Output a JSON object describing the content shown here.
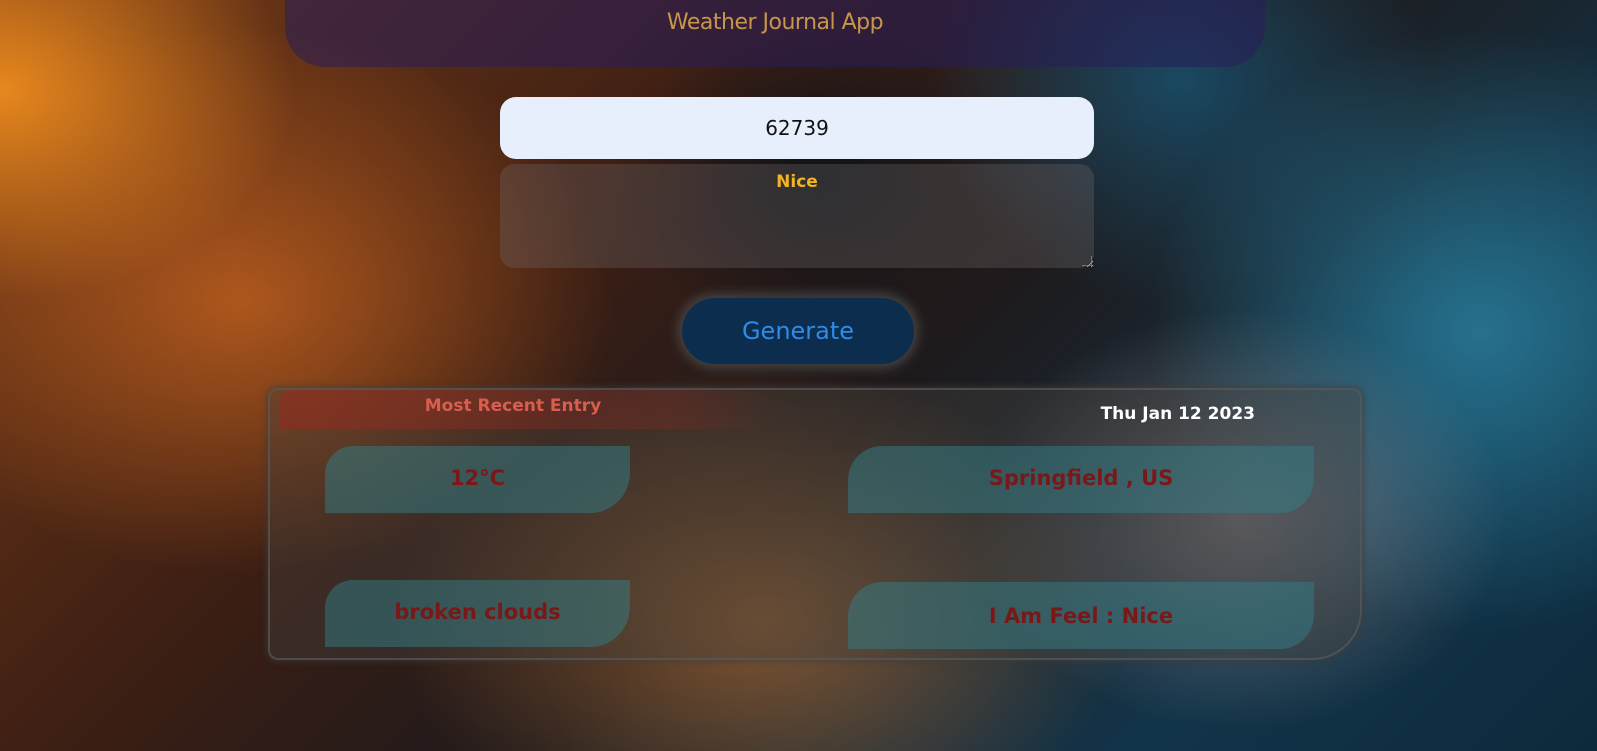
{
  "header": {
    "title": "Weather Journal App"
  },
  "form": {
    "zip_value": "62739",
    "feelings_value": "Nice",
    "generate_label": "Generate"
  },
  "entry": {
    "title": "Most Recent Entry",
    "date": "Thu Jan 12 2023",
    "temp": "12°C",
    "location": "Springfield , US",
    "description": "broken clouds",
    "feeling": "I Am Feel : Nice"
  },
  "colors": {
    "header_title": "#c8964a",
    "feelings_text": "#f4b320",
    "generate_text": "#2e8be8",
    "entry_title": "#d85e4f",
    "entry_values": "#7a1818"
  }
}
